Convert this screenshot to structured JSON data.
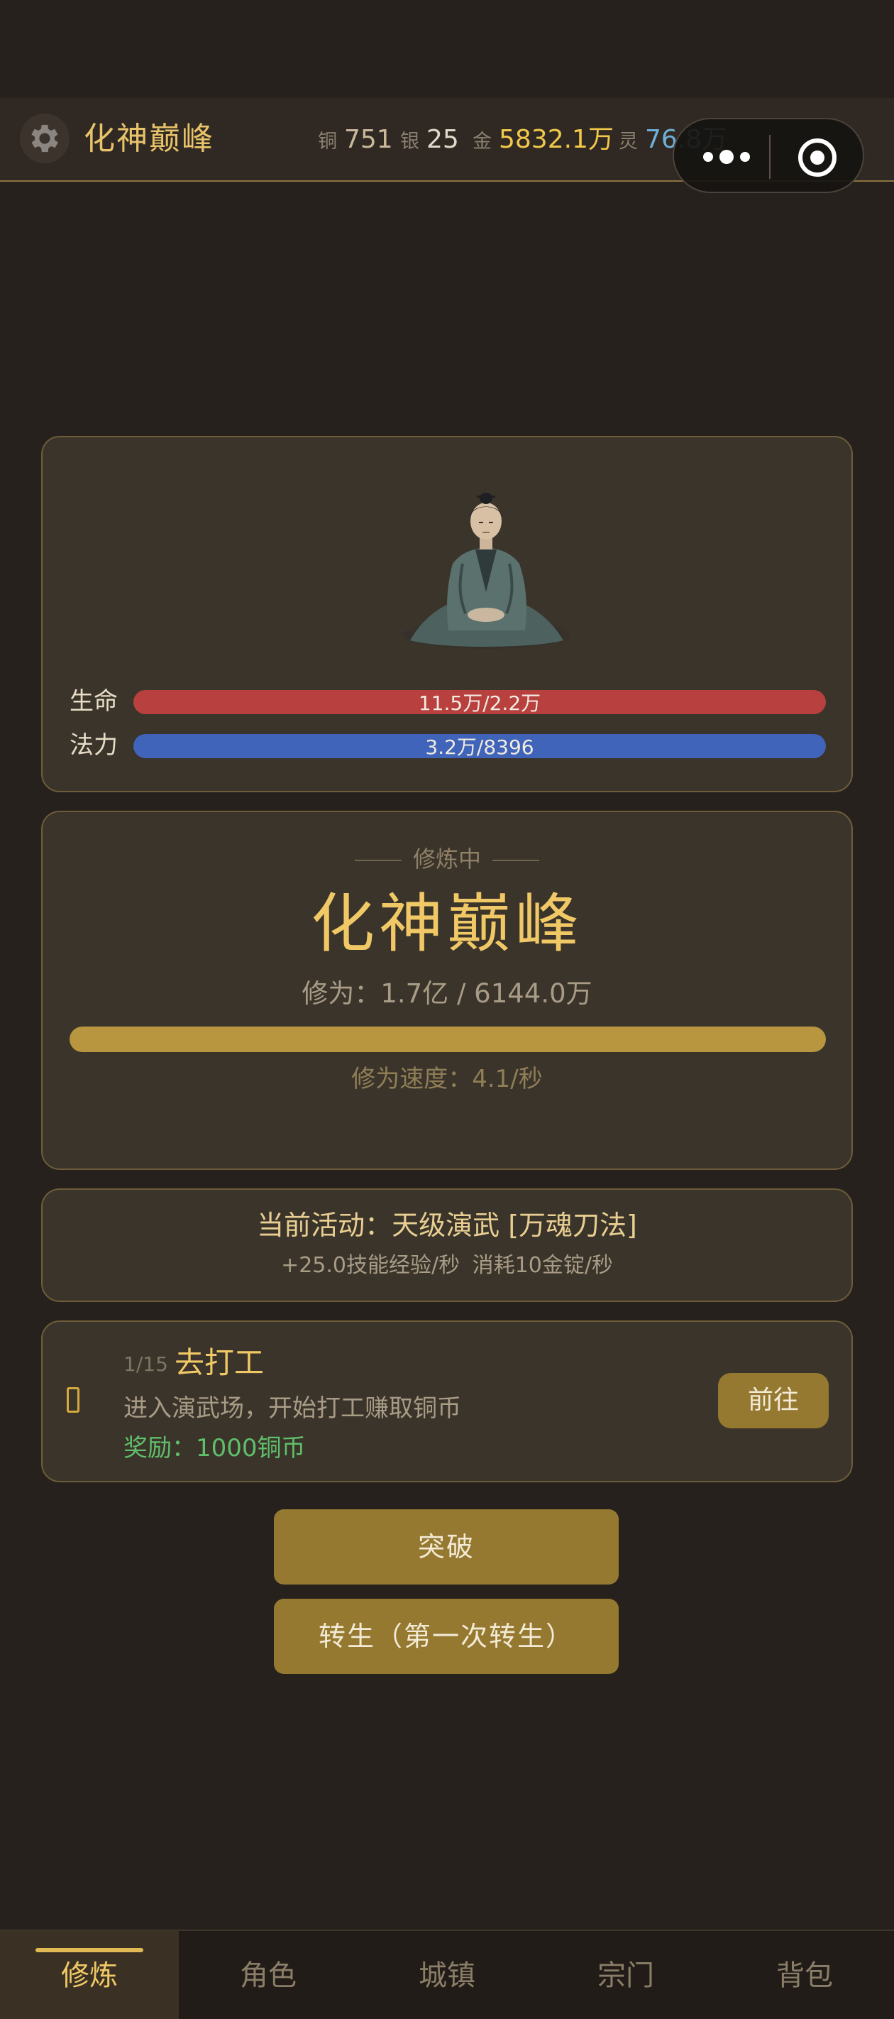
{
  "header": {
    "title": "化神巅峰",
    "currencies": [
      {
        "label": "铜",
        "value": "751",
        "color": "#c9b89a"
      },
      {
        "label": "银",
        "value": "25",
        "color": "#e0d8c8"
      },
      {
        "label": "金",
        "value": "5832.1万",
        "color": "#f2c84b"
      },
      {
        "label": "灵",
        "value": "76.8万",
        "color": "#6fb0d8"
      }
    ]
  },
  "character": {
    "hp": {
      "label": "生命",
      "text": "11.5万/2.2万",
      "color": "#b8403f"
    },
    "mp": {
      "label": "法力",
      "text": "3.2万/8396",
      "color": "#3f64b9"
    }
  },
  "cultivation": {
    "status": "修炼中",
    "realm": "化神巅峰",
    "progress_text": "修为：1.7亿 / 6144.0万",
    "progress_fraction": 1.0,
    "speed_text": "修为速度：4.1/秒"
  },
  "activity": {
    "title": "当前活动：天级演武 [万魂刀法]",
    "subtitle": "+25.0技能经验/秒  消耗10金锭/秒"
  },
  "task": {
    "step": "1/15",
    "title": "去打工",
    "description": "进入演武场，开始打工赚取铜币",
    "reward": "奖励：1000铜币",
    "go_label": "前往"
  },
  "actions": {
    "breakthrough_label": "突破",
    "rebirth_label": "转生（第一次转生）"
  },
  "nav": {
    "items": [
      "修炼",
      "角色",
      "城镇",
      "宗门",
      "背包"
    ],
    "active_index": 0
  }
}
